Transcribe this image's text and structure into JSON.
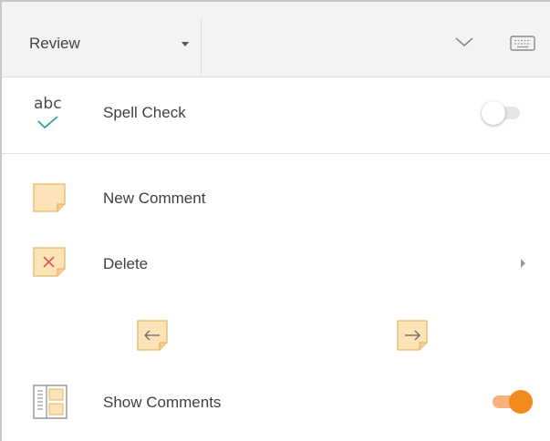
{
  "ribbon": {
    "tab_label": "Review"
  },
  "spell_check": {
    "icon_text": "abc",
    "label": "Spell Check",
    "enabled": false
  },
  "comments": {
    "new_label": "New Comment",
    "delete_label": "Delete"
  },
  "show_comments": {
    "label": "Show Comments",
    "enabled": true
  },
  "colors": {
    "accent": "#f28a1e",
    "note_fill": "#fde3b8",
    "note_border": "#e4b766",
    "check_teal": "#2aa198",
    "delete_red": "#e0544c"
  }
}
